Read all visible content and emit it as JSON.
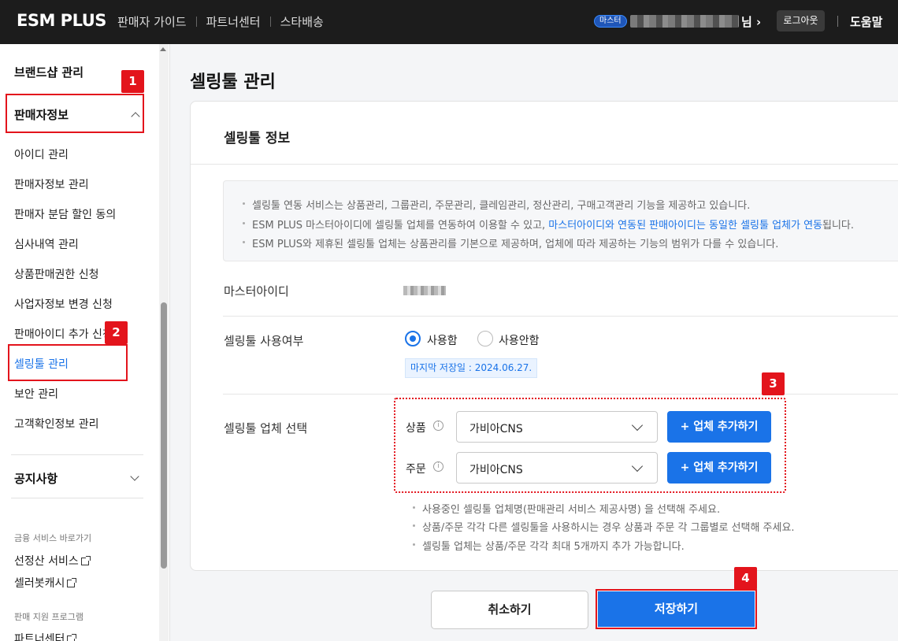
{
  "header": {
    "logo": "ESM PLUS",
    "nav": [
      "판매자 가이드",
      "파트너센터",
      "스타배송"
    ],
    "master_badge": "마스터",
    "user_suffix": "님 ›",
    "logout": "로그아웃",
    "help": "도움말"
  },
  "sidebar": {
    "brand_shop": "브랜드샵 관리",
    "section_seller": "판매자정보",
    "items": [
      "아이디 관리",
      "판매자정보 관리",
      "판매자 분담 할인 동의",
      "심사내역 관리",
      "상품판매권한 신청",
      "사업자정보 변경 신청",
      "판매아이디 추가 신청",
      "셀링툴 관리",
      "보안 관리",
      "고객확인정보 관리"
    ],
    "active_item": "셀링툴 관리",
    "notice": "공지사항",
    "finance_heading": "금융 서비스 바로가기",
    "finance_links": [
      "선정산 서비스",
      "셀러봇캐시"
    ],
    "support_heading": "판매 지원 프로그램",
    "support_links": [
      "파트너센터"
    ]
  },
  "page": {
    "title": "셀링툴 관리",
    "card_title": "셀링툴 정보",
    "notices": [
      "셀링툴 연동 서비스는 상품관리, 그룹관리, 주문관리, 클레임관리, 정산관리, 구매고객관리 기능을 제공하고 있습니다.",
      {
        "pre": "ESM PLUS 마스터아이디에 셀링툴 업체를 연동하여 이용할 수 있고, ",
        "highlight": "마스터아이디와 연동된 판매아이디는 동일한 셀링툴 업체가 연동",
        "post": "됩니다."
      },
      "ESM PLUS와 제휴된 셀링툴 업체는 상품관리를 기본으로 제공하며, 업체에 따라 제공하는 기능의 범위가 다를 수 있습니다."
    ],
    "master_id_label": "마스터아이디",
    "usage_label": "셀링툴 사용여부",
    "usage_options": [
      "사용함",
      "사용안함"
    ],
    "usage_selected": "사용함",
    "last_saved": "마지막 저장일 : 2024.06.27.",
    "vendor_label": "셀링툴 업체 선택",
    "vendor_rows": [
      {
        "label": "상품",
        "selected": "가비아CNS",
        "add": "+ 업체 추가하기"
      },
      {
        "label": "주문",
        "selected": "가비아CNS",
        "add": "+ 업체 추가하기"
      }
    ],
    "help_lines": [
      "사용중인 셀링툴 업체명(판매관리 서비스 제공사명) 을 선택해 주세요.",
      "상품/주문 각각 다른 셀링툴을 사용하시는 경우 상품과 주문 각 그룹별로 선택해 주세요.",
      "셀링툴 업체는 상품/주문 각각 최대 5개까지 추가 가능합니다."
    ],
    "cancel": "취소하기",
    "save": "저장하기"
  },
  "markers": [
    "1",
    "2",
    "3",
    "4"
  ],
  "colors": {
    "accent": "#1a73e8",
    "annotation": "#e3141c",
    "topbar": "#1c1c1c"
  }
}
